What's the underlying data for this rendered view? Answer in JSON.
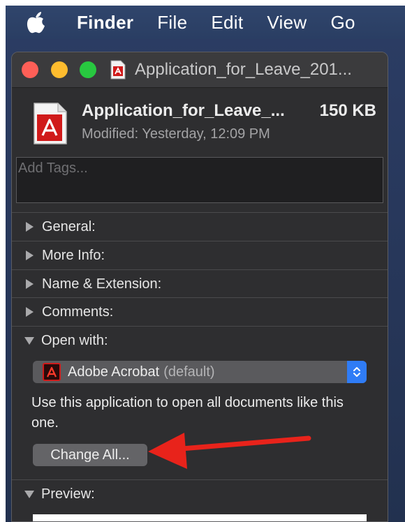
{
  "menubar": {
    "apple_icon": "apple-logo-icon",
    "items": [
      "Finder",
      "File",
      "Edit",
      "View",
      "Go"
    ]
  },
  "window": {
    "title": "Application_for_Leave_201...",
    "traffic_lights": {
      "close": "#fe5f57",
      "minimize": "#febc2e",
      "zoom": "#28c840"
    }
  },
  "file": {
    "name": "Application_for_Leave_...",
    "size": "150 KB",
    "modified_label": "Modified:",
    "modified_value": "Yesterday, 12:09 PM",
    "icon": "pdf-document-icon"
  },
  "tags": {
    "placeholder": "Add Tags..."
  },
  "sections": {
    "general": "General:",
    "more_info": "More Info:",
    "name_extension": "Name & Extension:",
    "comments": "Comments:",
    "open_with": "Open with:",
    "preview": "Preview:"
  },
  "open_with": {
    "app_name": "Adobe Acrobat",
    "default_tag": "(default)",
    "description": "Use this application to open all documents like this one.",
    "change_all_label": "Change All..."
  },
  "colors": {
    "accent_blue": "#2f7cf6",
    "annotation_red": "#e8231b",
    "window_bg": "#2e2e30"
  }
}
